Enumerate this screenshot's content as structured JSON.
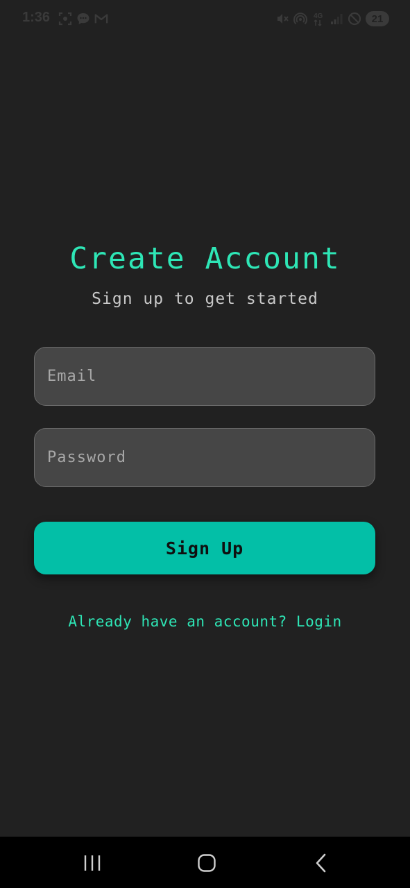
{
  "status_bar": {
    "time": "1:36",
    "left_icons": [
      "screenshot-icon",
      "message-icon",
      "gmail-icon"
    ],
    "right_icons": [
      "mute-icon",
      "hotspot-icon",
      "network-4g-icon",
      "signal-icon",
      "do-not-disturb-icon"
    ],
    "battery": "21",
    "color": "#3a3a3a"
  },
  "main": {
    "title": "Create Account",
    "subtitle": "Sign up to get started",
    "email_placeholder": "Email",
    "password_placeholder": "Password",
    "signup_label": "Sign Up",
    "login_link": "Already have an account? Login"
  },
  "nav_bar": {
    "icons": [
      "recents-icon",
      "home-icon",
      "back-icon"
    ]
  },
  "colors": {
    "background": "#212121",
    "accent": "#2ee6b6",
    "button": "#03bfa7",
    "field_background": "#464646",
    "field_border": "#6a6a6a",
    "nav_background": "#000000"
  }
}
